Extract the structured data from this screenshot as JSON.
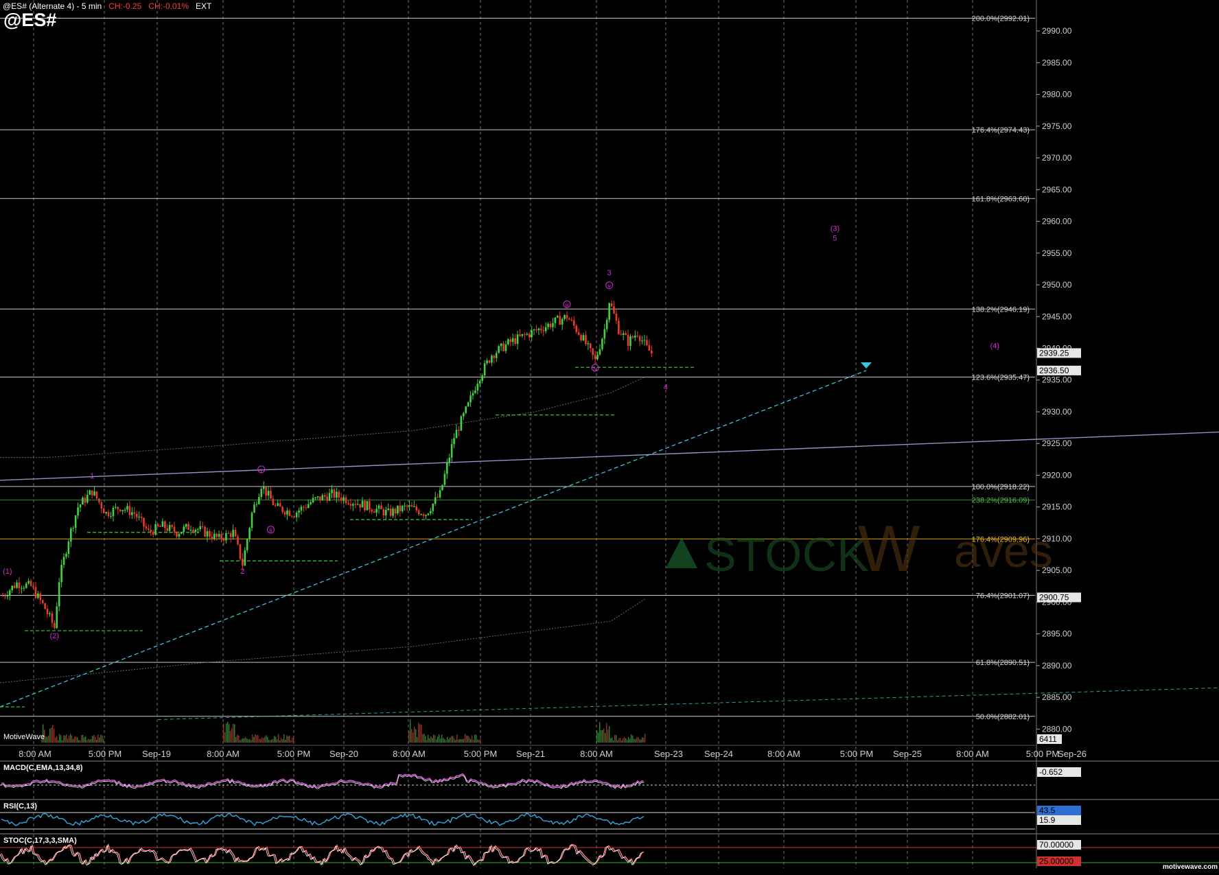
{
  "header": {
    "title": "@ES# (Alternate 4) - 5 min",
    "ch_points": "CH:-0.25",
    "ch_pct": "CH:-0.01%",
    "session": "EXT",
    "symbol": "@ES#"
  },
  "branding": {
    "platform": "MotiveWave",
    "site": "motivewave.com"
  },
  "colors": {
    "background": "#000000",
    "grid": "#8a8a8a",
    "up_bar": "#41d341",
    "down_bar": "#e63c2a",
    "fib_line": "#c8c8c8",
    "wave_label": "#d62bd6",
    "trendline_cyan": "#3bc4e0",
    "trendline_slate": "#8f97c7",
    "support_dash": "#2fbf2f",
    "gold_line": "#d4a017",
    "macd": "#e65ce6",
    "rsi": "#36a8e0",
    "stoch_k": "#ff8080",
    "stoch_d": "#ffffff"
  },
  "chart_data": [
    {
      "type": "line",
      "panel": "price",
      "subtype": "candlestick",
      "x_tick_labels": [
        "8:00 AM",
        "5:00 PM",
        "Sep-19",
        "8:00 AM",
        "5:00 PM",
        "Sep-20",
        "8:00 AM",
        "5:00 PM",
        "Sep-21",
        "8:00 AM",
        "Sep-23",
        "Sep-24",
        "8:00 AM",
        "5:00 PM",
        "Sep-25",
        "8:00 AM",
        "5:00 PM",
        "Sep-26"
      ],
      "y_ticks": [
        2880,
        2885,
        2890,
        2895,
        2900,
        2905,
        2910,
        2915,
        2920,
        2925,
        2930,
        2935,
        2940,
        2945,
        2950,
        2955,
        2960,
        2965,
        2970,
        2975,
        2980,
        2985,
        2990
      ],
      "y_tick_labels": [
        "2880.00",
        "2885.00",
        "2890.00",
        "2895.00",
        "2900.00",
        "2905.00",
        "2910.00",
        "2915.00",
        "2920.00",
        "2925.00",
        "2930.00",
        "2935.00",
        "2940.00",
        "2945.00",
        "2950.00",
        "2955.00",
        "2960.00",
        "2965.00",
        "2970.00",
        "2975.00",
        "2980.00",
        "2985.00",
        "2990.00"
      ],
      "ylim": [
        2879.5,
        2992.5
      ],
      "grid": true,
      "price_path": [
        [
          0,
          2901
        ],
        [
          3,
          2903
        ],
        [
          6,
          2902.5
        ],
        [
          9,
          2899
        ],
        [
          11,
          2896
        ],
        [
          12,
          2903.5
        ],
        [
          14,
          2910
        ],
        [
          16,
          2915
        ],
        [
          19,
          2917.5
        ],
        [
          22,
          2914
        ],
        [
          25,
          2915
        ],
        [
          28,
          2914
        ],
        [
          31,
          2911
        ],
        [
          34,
          2912
        ],
        [
          37,
          2911
        ],
        [
          40,
          2912
        ],
        [
          43,
          2911
        ],
        [
          46,
          2910
        ],
        [
          49,
          2911
        ],
        [
          51,
          2906
        ],
        [
          53,
          2914
        ],
        [
          55,
          2918.5
        ],
        [
          58,
          2915
        ],
        [
          62,
          2914
        ],
        [
          66,
          2916
        ],
        [
          70,
          2917
        ],
        [
          74,
          2916
        ],
        [
          78,
          2915
        ],
        [
          82,
          2914
        ],
        [
          86,
          2915
        ],
        [
          90,
          2914
        ],
        [
          93,
          2917
        ],
        [
          96,
          2926
        ],
        [
          99,
          2931
        ],
        [
          101,
          2935
        ],
        [
          104,
          2939
        ],
        [
          108,
          2941
        ],
        [
          111,
          2942
        ],
        [
          114,
          2943
        ],
        [
          117,
          2944
        ],
        [
          120,
          2945
        ],
        [
          123,
          2942
        ],
        [
          126,
          2938
        ],
        [
          128,
          2943
        ],
        [
          129,
          2947.5
        ],
        [
          131,
          2943
        ],
        [
          133,
          2941
        ],
        [
          135,
          2942.5
        ],
        [
          137,
          2940
        ],
        [
          138,
          2939.25
        ]
      ],
      "fib_levels": [
        {
          "label": "200.0%(2992.01)",
          "value": 2992.01
        },
        {
          "label": "176.4%(2974.43)",
          "value": 2974.43
        },
        {
          "label": "161.8%(2963.60)",
          "value": 2963.6
        },
        {
          "label": "138.2%(2946.19)",
          "value": 2946.19
        },
        {
          "label": "123.6%(2935.47)",
          "value": 2935.47
        },
        {
          "label": "100.0%(2918.22)",
          "value": 2918.22
        },
        {
          "label": "238.2%(2916.09)",
          "value": 2916.09
        },
        {
          "label": "176.4%(2909.96)",
          "value": 2909.96
        },
        {
          "label": "76.4%(2901.07)",
          "value": 2901.07
        },
        {
          "label": "61.8%(2890.51)",
          "value": 2890.51
        },
        {
          "label": "50.0%(2882.01)",
          "value": 2882.01
        }
      ],
      "price_badges": [
        {
          "label": "2939.25",
          "value": 2939.25
        },
        {
          "label": "2936.50",
          "value": 2936.5
        },
        {
          "label": "2900.75",
          "value": 2900.75
        }
      ],
      "volume_label": "6411",
      "wave_labels": [
        {
          "text": "(1)",
          "x": 1,
          "y": 2904.5
        },
        {
          "text": "(2)",
          "x": 11,
          "y": 2894.3
        },
        {
          "text": "1",
          "x": 19,
          "y": 2919.5
        },
        {
          "text": "2",
          "x": 51,
          "y": 2904.5
        },
        {
          "text": "i",
          "x": 55,
          "y": 2920.5,
          "circled": true
        },
        {
          "text": "ii",
          "x": 57,
          "y": 2911,
          "circled": true
        },
        {
          "text": "iii",
          "x": 120,
          "y": 2946.5,
          "circled": true
        },
        {
          "text": "iv",
          "x": 126,
          "y": 2936.5,
          "circled": true
        },
        {
          "text": "v",
          "x": 129,
          "y": 2949.5,
          "circled": true
        },
        {
          "text": "3",
          "x": 129,
          "y": 2951.5
        },
        {
          "text": "4",
          "x": 141,
          "y": 2933.5
        },
        {
          "text": "(3)",
          "x": 177,
          "y": 2958.5
        },
        {
          "text": "5",
          "x": 177,
          "y": 2957
        },
        {
          "text": "(4)",
          "x": 211,
          "y": 2940
        }
      ],
      "watermark": "StockWaves"
    },
    {
      "type": "line",
      "panel": "macd",
      "title": "MACD(C,EMA,13,34,8)",
      "value_labels": [
        "-0.652"
      ]
    },
    {
      "type": "line",
      "panel": "rsi",
      "title": "RSI(C,13)",
      "value_labels": [
        "43.5",
        "15.9"
      ]
    },
    {
      "type": "line",
      "panel": "stochastic",
      "title": "STOC(C,17,3,3,SMA)",
      "value_labels": [
        "70.00000",
        "25.00000"
      ]
    }
  ]
}
